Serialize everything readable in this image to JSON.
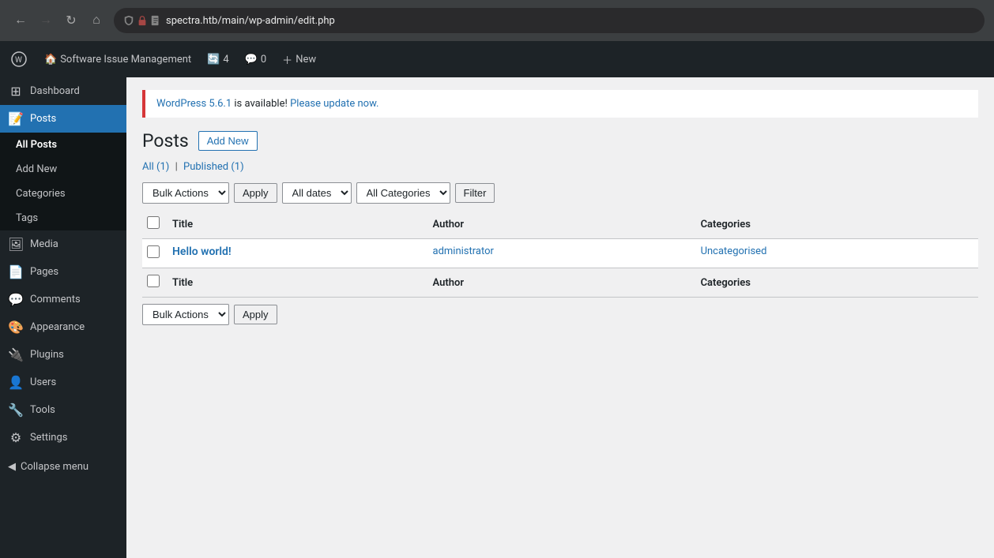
{
  "browser": {
    "url": "spectra.htb/main/wp-admin/edit.php",
    "back_disabled": false,
    "forward_disabled": true
  },
  "admin_bar": {
    "site_name": "Software Issue Management",
    "updates_count": "4",
    "comments_count": "0",
    "new_label": "New"
  },
  "sidebar": {
    "items": [
      {
        "id": "dashboard",
        "label": "Dashboard",
        "icon": "⊞"
      },
      {
        "id": "posts",
        "label": "Posts",
        "icon": "📝",
        "active": true
      },
      {
        "id": "media",
        "label": "Media",
        "icon": "🖼"
      },
      {
        "id": "pages",
        "label": "Pages",
        "icon": "📄"
      },
      {
        "id": "comments",
        "label": "Comments",
        "icon": "💬"
      },
      {
        "id": "appearance",
        "label": "Appearance",
        "icon": "🎨"
      },
      {
        "id": "plugins",
        "label": "Plugins",
        "icon": "🔌"
      },
      {
        "id": "users",
        "label": "Users",
        "icon": "👤"
      },
      {
        "id": "tools",
        "label": "Tools",
        "icon": "🔧"
      },
      {
        "id": "settings",
        "label": "Settings",
        "icon": "⚙"
      }
    ],
    "submenu": [
      {
        "id": "all-posts",
        "label": "All Posts",
        "active": true
      },
      {
        "id": "add-new",
        "label": "Add New"
      },
      {
        "id": "categories",
        "label": "Categories"
      },
      {
        "id": "tags",
        "label": "Tags"
      }
    ],
    "collapse_label": "Collapse menu"
  },
  "notice": {
    "version_link_text": "WordPress 5.6.1",
    "message": " is available! ",
    "update_link_text": "Please update now."
  },
  "page": {
    "title": "Posts",
    "add_new_label": "Add New"
  },
  "filter_tabs": {
    "all_label": "All",
    "all_count": "(1)",
    "separator": "|",
    "published_label": "Published",
    "published_count": "(1)"
  },
  "toolbar_top": {
    "bulk_actions_label": "Bulk Actions",
    "apply_label": "Apply",
    "all_dates_label": "All dates",
    "all_categories_label": "All Categories",
    "filter_label": "Filter"
  },
  "table": {
    "columns": [
      {
        "id": "title",
        "label": "Title"
      },
      {
        "id": "author",
        "label": "Author"
      },
      {
        "id": "categories",
        "label": "Categories"
      }
    ],
    "rows": [
      {
        "id": "1",
        "title": "Hello world!",
        "title_url": "#",
        "author": "administrator",
        "author_url": "#",
        "category": "Uncategorised",
        "category_url": "#"
      }
    ]
  },
  "toolbar_bottom": {
    "bulk_actions_label": "Bulk Actions",
    "apply_label": "Apply"
  }
}
